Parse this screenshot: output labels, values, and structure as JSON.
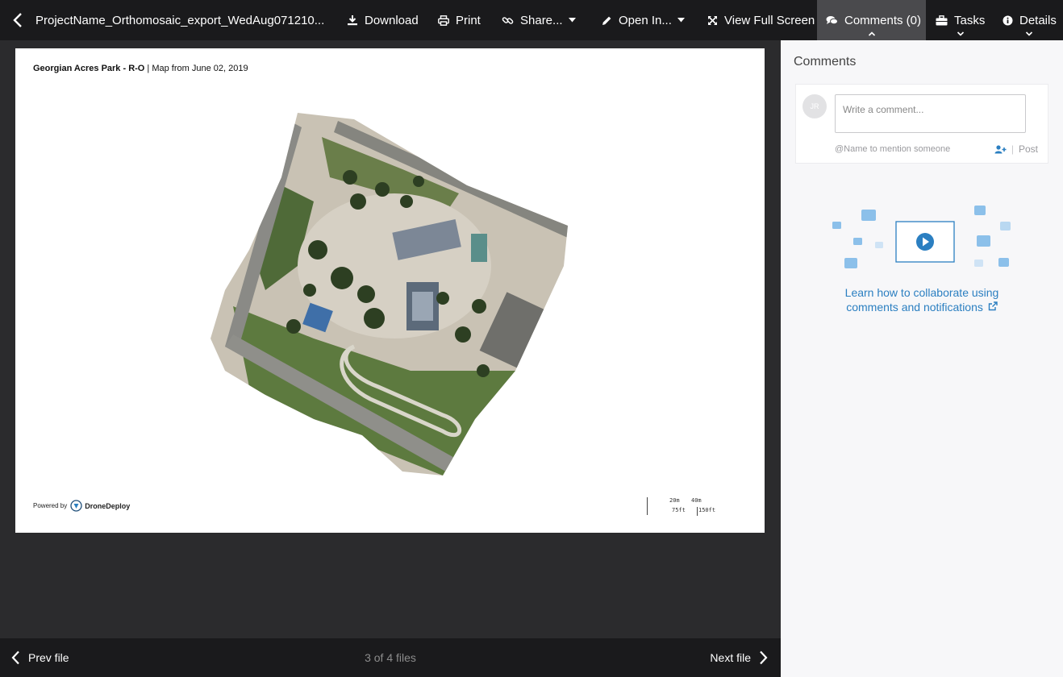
{
  "topbar": {
    "filename": "ProjectName_Orthomosaic_export_WedAug071210...",
    "download_label": "Download",
    "print_label": "Print",
    "share_label": "Share...",
    "open_in_label": "Open In...",
    "full_screen_label": "View Full Screen",
    "comments_label": "Comments (0)",
    "tasks_label": "Tasks",
    "details_label": "Details"
  },
  "document": {
    "title_bold": "Georgian Acres Park - R-O",
    "title_rest": " | Map from June 02, 2019",
    "powered_by": "Powered by",
    "brand": "DroneDeploy",
    "scale": {
      "m1": "20m",
      "m2": "40m",
      "ft1": "75ft",
      "ft2": "150ft"
    }
  },
  "bottombar": {
    "prev_label": "Prev file",
    "count": "3 of 4 files",
    "next_label": "Next file"
  },
  "comments_panel": {
    "title": "Comments",
    "avatar_initials": "JR",
    "placeholder": "Write a comment...",
    "mention_hint": "@Name to mention someone",
    "post_label": "Post",
    "learn_line1": "Learn how to collaborate using",
    "learn_line2": "comments and notifications"
  },
  "colors": {
    "accent": "#2b7fc1",
    "topbar_bg": "#1a1a1c",
    "viewer_bg": "#2b2b2d",
    "panel_bg": "#f7f7f9"
  }
}
